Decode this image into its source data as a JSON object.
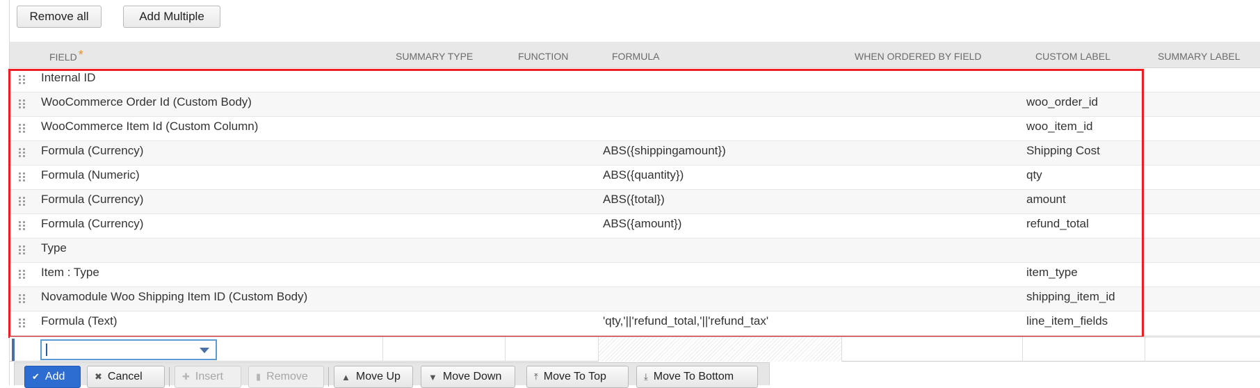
{
  "buttons": {
    "remove_all": "Remove all",
    "add_multiple": "Add Multiple"
  },
  "columns": [
    "FIELD",
    "SUMMARY TYPE",
    "FUNCTION",
    "FORMULA",
    "WHEN ORDERED BY FIELD",
    "CUSTOM LABEL",
    "SUMMARY LABEL"
  ],
  "required_marker": "*",
  "rows": [
    {
      "field": "Internal ID",
      "formula": "",
      "label": ""
    },
    {
      "field": "WooCommerce Order Id (Custom Body)",
      "formula": "",
      "label": "woo_order_id"
    },
    {
      "field": "WooCommerce Item Id (Custom Column)",
      "formula": "",
      "label": "woo_item_id"
    },
    {
      "field": "Formula (Currency)",
      "formula": "ABS({shippingamount})",
      "label": "Shipping Cost"
    },
    {
      "field": "Formula (Numeric)",
      "formula": "ABS({quantity})",
      "label": "qty"
    },
    {
      "field": "Formula (Currency)",
      "formula": "ABS({total})",
      "label": "amount"
    },
    {
      "field": "Formula (Currency)",
      "formula": "ABS({amount})",
      "label": "refund_total"
    },
    {
      "field": "Type",
      "formula": "",
      "label": ""
    },
    {
      "field": "Item : Type",
      "formula": "",
      "label": "item_type"
    },
    {
      "field": "Novamodule Woo Shipping Item ID (Custom Body)",
      "formula": "",
      "label": "shipping_item_id"
    },
    {
      "field": "Formula (Text)",
      "formula": "'qty,'||'refund_total,'||'refund_tax'",
      "label": "line_item_fields"
    }
  ],
  "edit_row": {
    "field_value": ""
  },
  "toolbar": {
    "add": "Add",
    "cancel": "Cancel",
    "insert": "Insert",
    "remove": "Remove",
    "move_up": "Move Up",
    "move_down": "Move Down",
    "move_to_top": "Move To Top",
    "move_to_bottom": "Move To Bottom"
  },
  "icons": {
    "add": "check-icon",
    "cancel": "x-icon",
    "insert": "plus-icon",
    "remove": "trash-icon",
    "move_up": "arrow-up-icon",
    "move_down": "arrow-down-icon",
    "move_to_top": "arrow-to-top-icon",
    "move_to_bottom": "arrow-to-bottom-icon",
    "drag": "drag-handle-icon",
    "dropdown": "chevron-down-icon"
  },
  "colors": {
    "highlight": "#ee1c24",
    "primary": "#2d6cd1",
    "required": "#e0932b",
    "header_bg": "#e8e8e8"
  }
}
